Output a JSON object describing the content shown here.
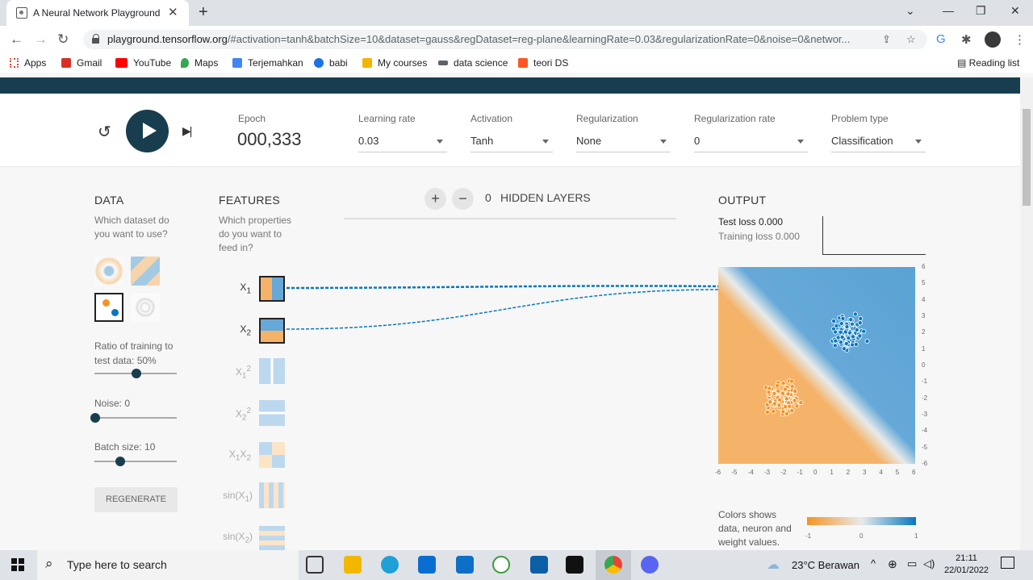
{
  "browser": {
    "tab_title": "A Neural Network Playground",
    "url_domain": "playground.tensorflow.org",
    "url_rest": "/#activation=tanh&batchSize=10&dataset=gauss&regDataset=reg-plane&learningRate=0.03&regularizationRate=0&noise=0&networ...",
    "bookmarks": [
      {
        "label": "Apps",
        "color": "#e34234"
      },
      {
        "label": "Gmail",
        "color": "#d93025"
      },
      {
        "label": "YouTube",
        "color": "#ff0000"
      },
      {
        "label": "Maps",
        "color": "#34a853"
      },
      {
        "label": "Terjemahkan",
        "color": "#4285f4"
      },
      {
        "label": "babi",
        "color": "#1a73e8"
      },
      {
        "label": "My courses",
        "color": "#f4b400"
      },
      {
        "label": "data science",
        "color": "#5f6368"
      },
      {
        "label": "teori DS",
        "color": "#ff5722"
      }
    ],
    "reading_list": "Reading list"
  },
  "controls": {
    "epoch_label": "Epoch",
    "epoch_value": "000,333",
    "learning_rate_label": "Learning rate",
    "learning_rate": "0.03",
    "activation_label": "Activation",
    "activation": "Tanh",
    "regularization_label": "Regularization",
    "regularization": "None",
    "reg_rate_label": "Regularization rate",
    "reg_rate": "0",
    "problem_label": "Problem type",
    "problem": "Classification"
  },
  "data": {
    "title": "DATA",
    "desc": "Which dataset do you want to use?",
    "ratio_label": "Ratio of training to test data:  50%",
    "ratio": 0.5,
    "noise_label": "Noise:  0",
    "noise": 0,
    "batch_label": "Batch size:  10",
    "batch": 0.3,
    "regenerate": "REGENERATE"
  },
  "features": {
    "title": "FEATURES",
    "desc": "Which properties do you want to feed in?"
  },
  "hidden": {
    "count": "0",
    "label": "HIDDEN LAYERS",
    "add": "+",
    "remove": "−"
  },
  "output": {
    "title": "OUTPUT",
    "test_loss": "Test loss 0.000",
    "train_loss": "Training loss 0.000",
    "legend": "Colors shows data, neuron and weight values.",
    "legend_ticks": [
      "-1",
      "0",
      "1"
    ],
    "axis_ticks": [
      "-6",
      "-5",
      "-4",
      "-3",
      "-2",
      "-1",
      "0",
      "1",
      "2",
      "3",
      "4",
      "5",
      "6"
    ]
  },
  "chart_data": {
    "type": "scatter",
    "xlim": [
      -6,
      6
    ],
    "ylim": [
      -6,
      6
    ],
    "series": [
      {
        "cluster_center": [
          2,
          2
        ],
        "color": "#0877bd"
      },
      {
        "cluster_center": [
          -2,
          -2
        ],
        "color": "#f59322"
      }
    ]
  },
  "taskbar": {
    "search_placeholder": "Type here to search",
    "weather": "23°C  Berawan",
    "time": "21:11",
    "date": "22/01/2022"
  }
}
